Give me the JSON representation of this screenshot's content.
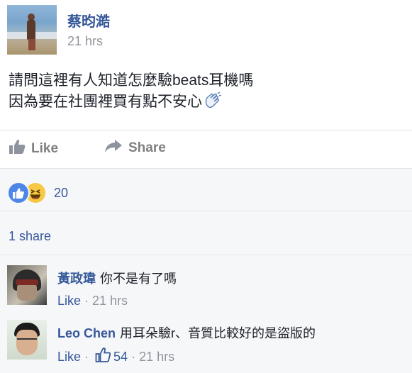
{
  "post": {
    "author": "蔡昀澔",
    "time": "21 hrs",
    "text_line1": "請問這裡有人知道怎麼驗beats耳機嗎",
    "text_line2": "因為要在社團裡買有點不安心",
    "text_line2_emoji": "waving-hand-emoji"
  },
  "actions": {
    "like_label": "Like",
    "share_label": "Share"
  },
  "reactions": {
    "types": [
      "like-icon",
      "haha-icon"
    ],
    "count": "20"
  },
  "shares": {
    "label": "1 share"
  },
  "comments": [
    {
      "author": "黃政瑋",
      "text": "你不是有了嗎",
      "like_label": "Like",
      "separator": "·",
      "time": "21 hrs"
    },
    {
      "author": "Leo Chen",
      "text": "用耳朵驗r、音質比較好的是盜版的",
      "like_label": "Like",
      "separator": "·",
      "like_count": "54",
      "separator2": "·",
      "time": "21 hrs"
    }
  ],
  "colors": {
    "link_blue": "#365899",
    "meta_grey": "#90949c",
    "like_reaction_blue": "#4e86e8",
    "haha_yellow": "#f7c844",
    "comments_bg": "#f6f7f9"
  }
}
